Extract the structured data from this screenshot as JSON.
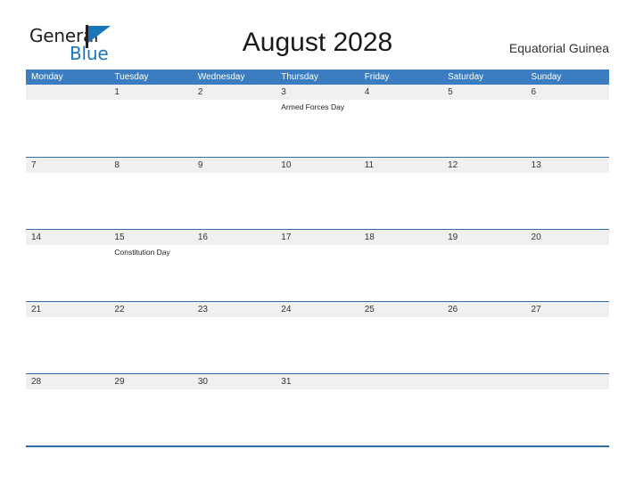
{
  "brand": {
    "name_part1": "General",
    "name_part2": "Blue",
    "flag_icon": "blue-flag-icon",
    "accent_color": "#1b75bb"
  },
  "header": {
    "title": "August 2028",
    "locale": "Equatorial Guinea"
  },
  "colors": {
    "header_blue": "#3b7dc0",
    "rule_blue": "#2f6ca8",
    "day_band_gray": "#f0f0f0",
    "text_dark": "#333333"
  },
  "calendar": {
    "weekdays": [
      "Monday",
      "Tuesday",
      "Wednesday",
      "Thursday",
      "Friday",
      "Saturday",
      "Sunday"
    ],
    "weeks": [
      [
        {
          "date": "",
          "events": []
        },
        {
          "date": "1",
          "events": []
        },
        {
          "date": "2",
          "events": []
        },
        {
          "date": "3",
          "events": [
            "Armed Forces Day"
          ]
        },
        {
          "date": "4",
          "events": []
        },
        {
          "date": "5",
          "events": []
        },
        {
          "date": "6",
          "events": []
        }
      ],
      [
        {
          "date": "7",
          "events": []
        },
        {
          "date": "8",
          "events": []
        },
        {
          "date": "9",
          "events": []
        },
        {
          "date": "10",
          "events": []
        },
        {
          "date": "11",
          "events": []
        },
        {
          "date": "12",
          "events": []
        },
        {
          "date": "13",
          "events": []
        }
      ],
      [
        {
          "date": "14",
          "events": []
        },
        {
          "date": "15",
          "events": [
            "Constitution Day"
          ]
        },
        {
          "date": "16",
          "events": []
        },
        {
          "date": "17",
          "events": []
        },
        {
          "date": "18",
          "events": []
        },
        {
          "date": "19",
          "events": []
        },
        {
          "date": "20",
          "events": []
        }
      ],
      [
        {
          "date": "21",
          "events": []
        },
        {
          "date": "22",
          "events": []
        },
        {
          "date": "23",
          "events": []
        },
        {
          "date": "24",
          "events": []
        },
        {
          "date": "25",
          "events": []
        },
        {
          "date": "26",
          "events": []
        },
        {
          "date": "27",
          "events": []
        }
      ],
      [
        {
          "date": "28",
          "events": []
        },
        {
          "date": "29",
          "events": []
        },
        {
          "date": "30",
          "events": []
        },
        {
          "date": "31",
          "events": []
        },
        {
          "date": "",
          "events": []
        },
        {
          "date": "",
          "events": []
        },
        {
          "date": "",
          "events": []
        }
      ]
    ]
  }
}
